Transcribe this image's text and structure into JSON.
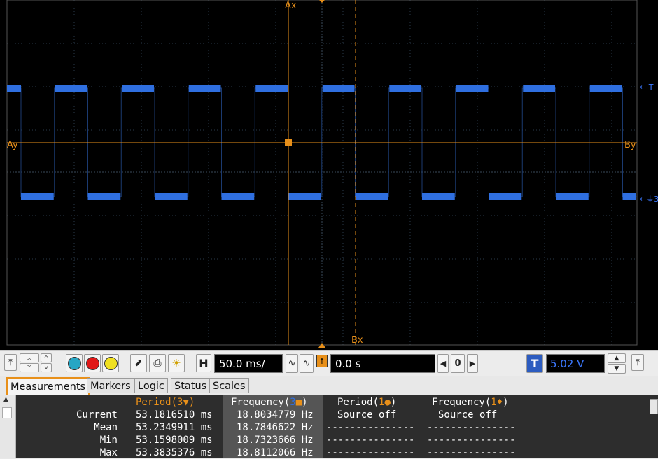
{
  "scope": {
    "cursor_labels": {
      "ax": "Ax",
      "ay": "Ay",
      "bx": "Bx",
      "by": "By"
    },
    "channel_markers": {
      "trigger": "T",
      "channel": "3"
    },
    "colors": {
      "background": "#000000",
      "grid": "#2a3a4a",
      "trace": "#2f6fe0",
      "cursor": "#e8901a"
    }
  },
  "toolbar": {
    "timebase": "50.0 ms/",
    "h_label": "H",
    "delay": "0.0 s",
    "zero_label": "0",
    "trigger_label": "T",
    "trigger_level": "5.02 V",
    "channel_colors": [
      "#27a6c4",
      "#e01818",
      "#f0e020"
    ]
  },
  "tabs": [
    "Measurements",
    "Markers",
    "Logic",
    "Status",
    "Scales"
  ],
  "measurements": {
    "headers": [
      {
        "label": "Period(",
        "source": "3",
        "marker": "▼",
        "close": ")"
      },
      {
        "label": "Frequency(",
        "source": "3",
        "marker": "■",
        "close": ")"
      },
      {
        "label": "Period(",
        "source": "1",
        "marker": "●",
        "close": ")"
      },
      {
        "label": "Frequency(",
        "source": "1",
        "marker": "♦",
        "close": ")"
      }
    ],
    "rows": [
      {
        "label": "Current",
        "period": "53.1816510 ms",
        "frequency": "18.8034779 Hz",
        "p1": "Source off",
        "f1": "Source off"
      },
      {
        "label": "Mean",
        "period": "53.2349911 ms",
        "frequency": "18.7846622 Hz",
        "p1": "---------------",
        "f1": "---------------"
      },
      {
        "label": "Min",
        "period": "53.1598009 ms",
        "frequency": "18.7323666 Hz",
        "p1": "---------------",
        "f1": "---------------"
      },
      {
        "label": "Max",
        "period": "53.3835376 ms",
        "frequency": "18.8112066 Hz",
        "p1": "---------------",
        "f1": "---------------"
      }
    ]
  }
}
